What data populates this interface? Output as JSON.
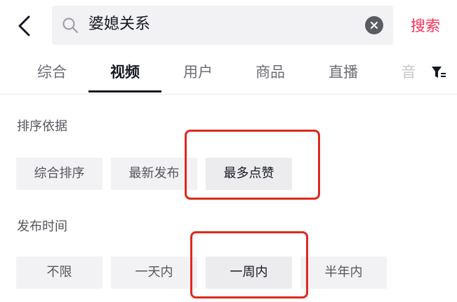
{
  "search": {
    "query": "婆媳关系",
    "submit_label": "搜索"
  },
  "tabs": [
    {
      "label": "综合",
      "active": false
    },
    {
      "label": "视频",
      "active": true
    },
    {
      "label": "用户",
      "active": false
    },
    {
      "label": "商品",
      "active": false
    },
    {
      "label": "直播",
      "active": false
    },
    {
      "label": "音",
      "active": false
    }
  ],
  "filters": {
    "sort": {
      "title": "排序依据",
      "options": [
        "综合排序",
        "最新发布",
        "最多点赞"
      ],
      "selected": "最多点赞"
    },
    "time": {
      "title": "发布时间",
      "options": [
        "不限",
        "一天内",
        "一周内",
        "半年内"
      ],
      "selected": "一周内"
    }
  },
  "colors": {
    "accent": "#fe2c55",
    "annotation": "#e0281f",
    "chip_background": "#f2f2f4"
  },
  "icons": [
    "back-arrow-icon",
    "search-icon",
    "clear-icon",
    "filter-icon"
  ]
}
